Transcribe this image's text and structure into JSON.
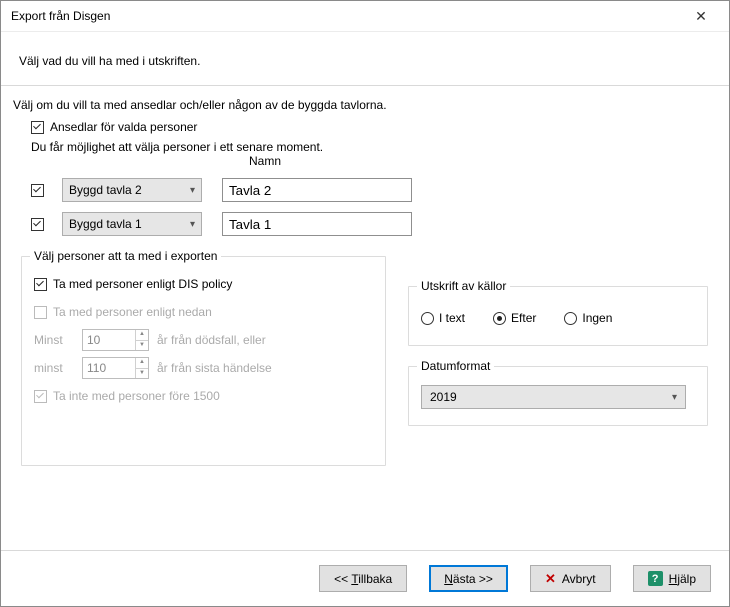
{
  "window": {
    "title": "Export från Disgen"
  },
  "heading": "Välj vad du vill ha med i utskriften.",
  "instruction": "Välj om du vill ta med ansedlar och/eller någon av de byggda tavlorna.",
  "ansedlar_label": "Ansedlar för valda personer",
  "hint": "Du får möjlighet att välja personer i ett senare moment.",
  "namn_header": "Namn",
  "tables": [
    {
      "combo": "Byggd tavla 2",
      "name": "Tavla 2"
    },
    {
      "combo": "Byggd tavla 1",
      "name": "Tavla 1"
    }
  ],
  "persons_group": {
    "legend": "Välj personer att ta med i exporten",
    "dis_policy": "Ta med personer enligt DIS policy",
    "enligt_nedan": "Ta med personer enligt nedan",
    "minst1_label": "Minst",
    "minst1_value": "10",
    "minst1_suffix": "år från dödsfall, eller",
    "minst2_label": "minst",
    "minst2_value": "110",
    "minst2_suffix": "år från sista händelse",
    "before1500": "Ta inte med personer före 1500"
  },
  "sources_group": {
    "legend": "Utskrift av källor",
    "options": [
      "I text",
      "Efter",
      "Ingen"
    ],
    "selected": 1
  },
  "date_group": {
    "legend": "Datumformat",
    "value": "2019"
  },
  "buttons": {
    "back": "<< Tillbaka",
    "next": "Nästa >>",
    "cancel": "Avbryt",
    "help": "Hjälp"
  }
}
